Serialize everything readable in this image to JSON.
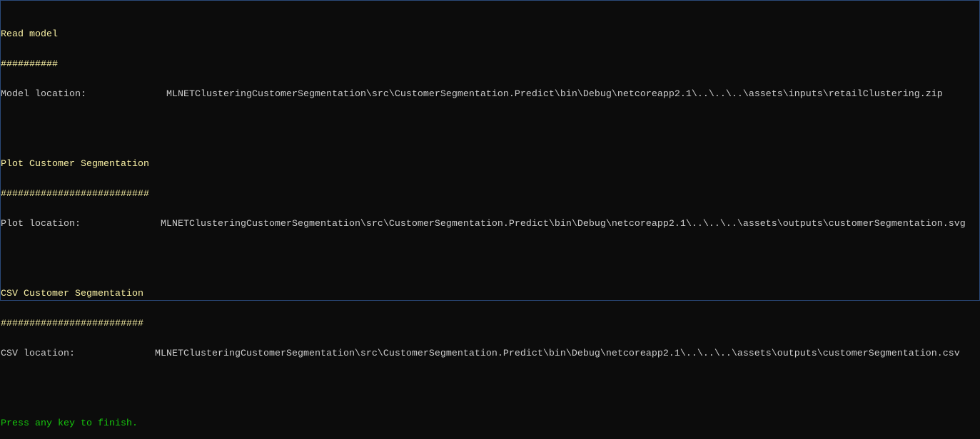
{
  "sections": [
    {
      "heading": "Read model",
      "underline": "##########",
      "label": "Model location:",
      "path": "MLNETClusteringCustomerSegmentation\\src\\CustomerSegmentation.Predict\\bin\\Debug\\netcoreapp2.1\\..\\..\\..\\assets\\inputs\\retailClustering.zip"
    },
    {
      "heading": "Plot Customer Segmentation",
      "underline": "##########################",
      "label": "Plot location:",
      "path": "MLNETClusteringCustomerSegmentation\\src\\CustomerSegmentation.Predict\\bin\\Debug\\netcoreapp2.1\\..\\..\\..\\assets\\outputs\\customerSegmentation.svg"
    },
    {
      "heading": "CSV Customer Segmentation",
      "underline": "#########################",
      "label": "CSV location:",
      "path": "MLNETClusteringCustomerSegmentation\\src\\CustomerSegmentation.Predict\\bin\\Debug\\netcoreapp2.1\\..\\..\\..\\assets\\outputs\\customerSegmentation.csv"
    }
  ],
  "footer": {
    "message": "Press any key to finish."
  },
  "colors": {
    "background": "#0c0c0c",
    "heading": "#f9f1a5",
    "text": "#cccccc",
    "prompt": "#16c60c"
  }
}
